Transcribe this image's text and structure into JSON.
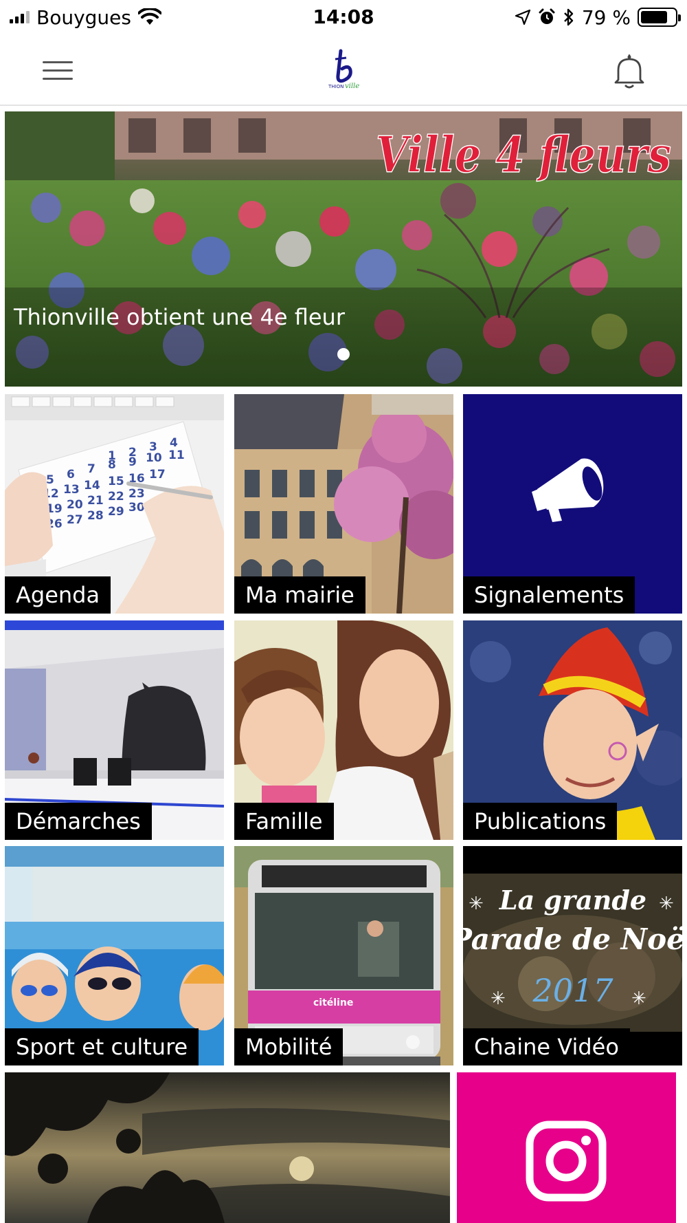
{
  "status_bar": {
    "carrier": "Bouygues",
    "time": "14:08",
    "battery_text": "79 %",
    "battery_level": 0.79,
    "icons": [
      "signal-bars-icon",
      "wifi-icon",
      "location-arrow-icon",
      "alarm-icon",
      "bluetooth-icon",
      "battery-icon"
    ]
  },
  "header": {
    "menu_icon": "hamburger-menu-icon",
    "logo_text": "THIONVILLE",
    "notification_icon": "bell-icon"
  },
  "banner": {
    "overlay_title": "Ville 4 fleurs",
    "caption": "Thionville obtient une 4e fleur",
    "slide_count": 1,
    "active_slide": 1
  },
  "tiles": [
    {
      "label": "Agenda"
    },
    {
      "label": "Ma mairie"
    },
    {
      "label": "Signalements",
      "icon": "megaphone-icon",
      "color": "#120c7b"
    },
    {
      "label": "Démarches"
    },
    {
      "label": "Famille"
    },
    {
      "label": "Publications"
    },
    {
      "label": "Sport et culture"
    },
    {
      "label": "Mobilité"
    },
    {
      "label": "Chaine Vidéo",
      "overlay_line1": "La grande",
      "overlay_line2": "Parade de Noël",
      "overlay_line3": "2017"
    }
  ],
  "bottom_tiles": [
    {
      "name": "moon-photo"
    },
    {
      "name": "instagram",
      "icon": "instagram-icon",
      "color": "#e6008a"
    }
  ]
}
